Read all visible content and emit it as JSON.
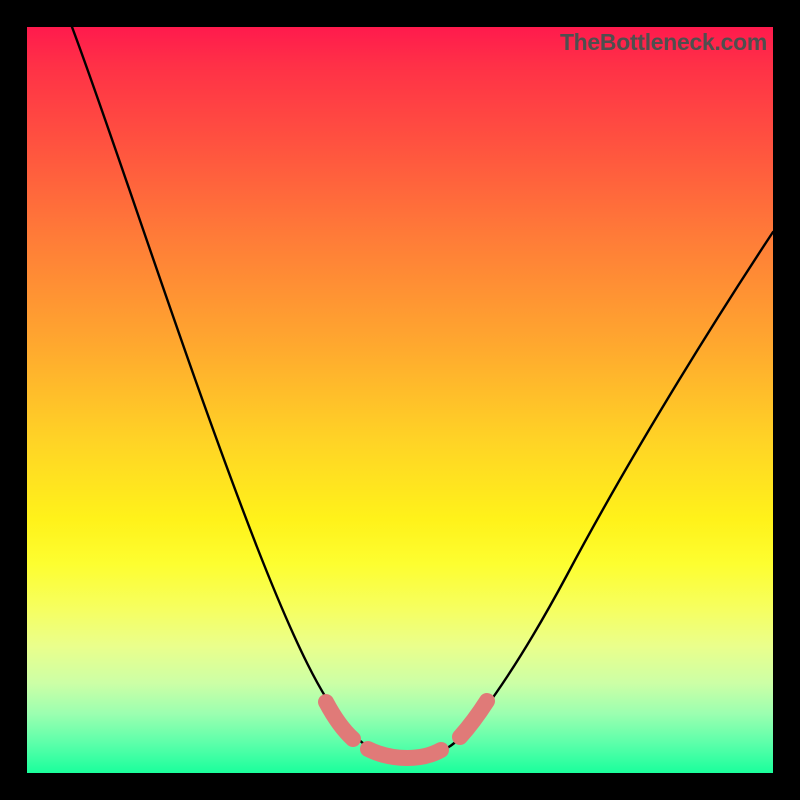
{
  "watermark": "TheBottleneck.com",
  "chart_data": {
    "type": "line",
    "title": "",
    "xlabel": "",
    "ylabel": "",
    "xlim": [
      0,
      100
    ],
    "ylim": [
      0,
      100
    ],
    "series": [
      {
        "name": "curve",
        "x": [
          6,
          10,
          15,
          20,
          25,
          30,
          34,
          37,
          40,
          42.5,
          45,
          47,
          49,
          51,
          53,
          55,
          57,
          60,
          65,
          70,
          75,
          80,
          85,
          90,
          95,
          100
        ],
        "y": [
          100,
          90,
          78,
          66,
          54,
          42,
          32,
          24,
          16,
          10,
          5.5,
          3.2,
          2.4,
          2.2,
          2.3,
          2.7,
          3.5,
          5.2,
          9.5,
          15,
          21,
          28,
          36,
          44,
          53,
          62
        ]
      },
      {
        "name": "highlight-segments",
        "points": [
          {
            "x_start": 40.0,
            "x_end": 44.0
          },
          {
            "x_start": 46.5,
            "x_end": 54.5
          },
          {
            "x_start": 57.0,
            "x_end": 60.5
          }
        ]
      }
    ],
    "annotations": []
  },
  "colors": {
    "curve_stroke": "#000000",
    "highlight": "#e07a78",
    "background_border": "#000000"
  }
}
